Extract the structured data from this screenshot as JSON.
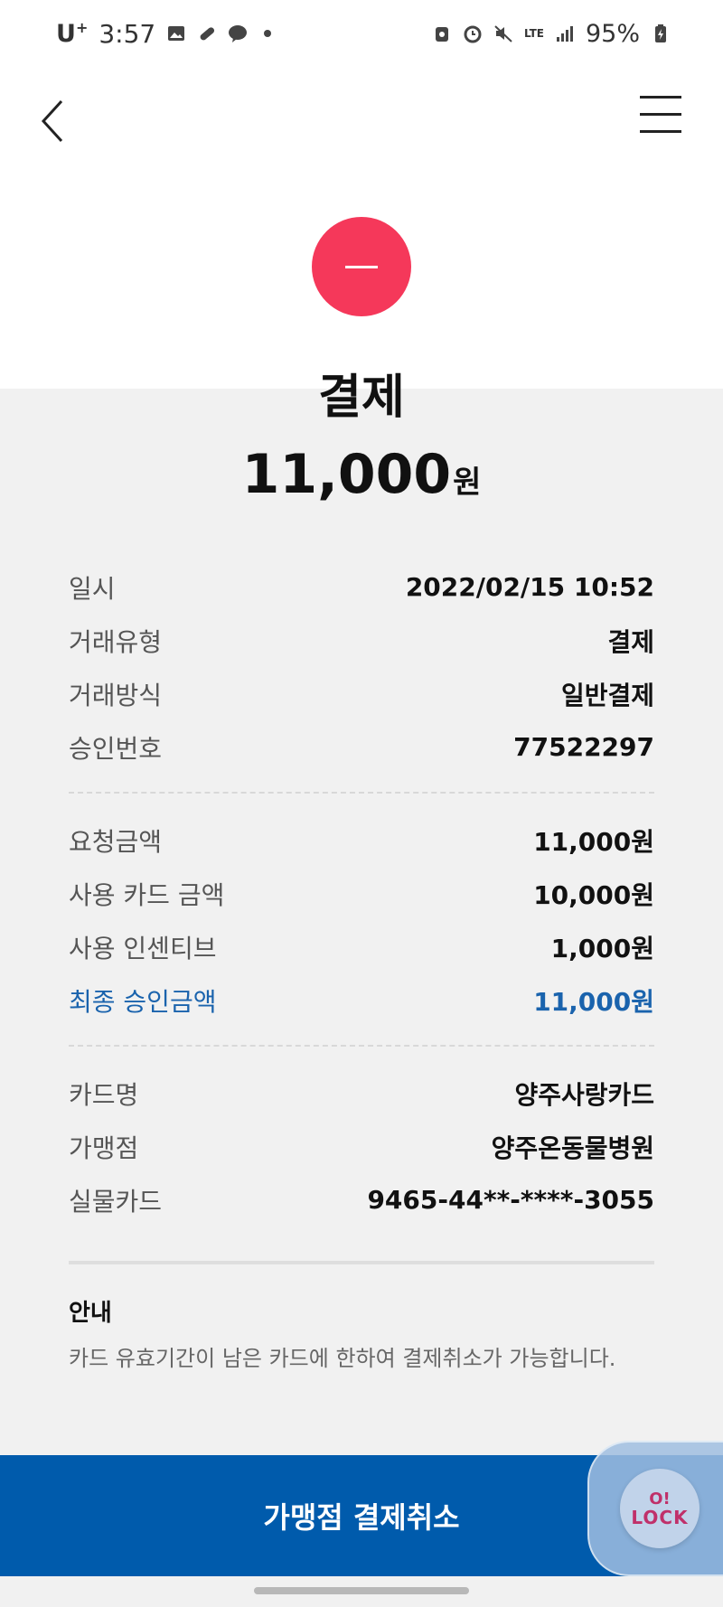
{
  "status_bar": {
    "carrier": "U",
    "carrier_sup": "+",
    "time": "3:57",
    "network": "LTE",
    "battery": "95%"
  },
  "header": {
    "back_icon": "chevron-left-icon",
    "menu_icon": "hamburger-menu-icon"
  },
  "transaction": {
    "status_icon": "minus-circle-icon",
    "status_color": "#f5385a",
    "title": "결제",
    "amount": "11,000",
    "unit": "원"
  },
  "details": {
    "group1": [
      {
        "label": "일시",
        "value": "2022/02/15 10:52"
      },
      {
        "label": "거래유형",
        "value": "결제"
      },
      {
        "label": "거래방식",
        "value": "일반결제"
      },
      {
        "label": "승인번호",
        "value": "77522297"
      }
    ],
    "group2": [
      {
        "label": "요청금액",
        "value": "11,000원"
      },
      {
        "label": "사용 카드 금액",
        "value": "10,000원"
      },
      {
        "label": "사용 인센티브",
        "value": "1,000원"
      },
      {
        "label": "최종 승인금액",
        "value": "11,000원"
      }
    ],
    "group3": [
      {
        "label": "카드명",
        "value": "양주사랑카드"
      },
      {
        "label": "가맹점",
        "value": "양주온동물병원"
      },
      {
        "label": "실물카드",
        "value": "9465-44**-****-3055"
      }
    ],
    "highlight_color": "#1a63ad"
  },
  "notice": {
    "title": "안내",
    "text": "카드 유효기간이 남은 카드에 한하여 결제취소가 가능합니다."
  },
  "bottom": {
    "button_label": "가맹점 결제취소",
    "button_color": "#005bac",
    "overlay_line1": "O!",
    "overlay_line2": "LOCK"
  }
}
